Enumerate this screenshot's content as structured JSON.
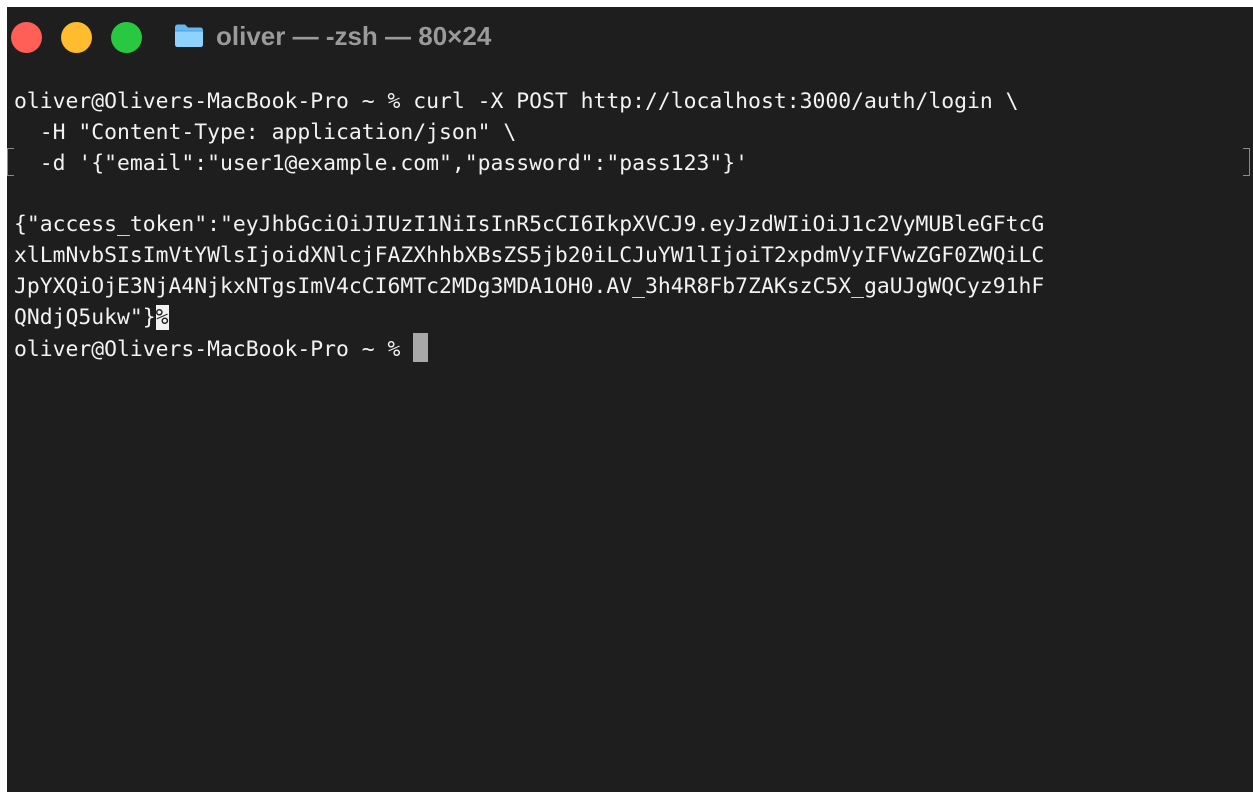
{
  "window": {
    "title": "oliver — -zsh — 80×24",
    "colors": {
      "background": "#1e1e1e",
      "text": "#f2f2f2",
      "title_text": "#9a9a9a",
      "close": "#ff5f57",
      "minimize": "#febc2e",
      "zoom": "#28c840",
      "cursor": "#a9a9a9"
    },
    "icons": {
      "folder": "folder-icon"
    }
  },
  "terminal": {
    "command_lines": [
      "oliver@Olivers-MacBook-Pro ~ % curl -X POST http://localhost:3000/auth/login \\",
      "  -H \"Content-Type: application/json\" \\",
      "  -d '{\"email\":\"user1@example.com\",\"password\":\"pass123\"}'"
    ],
    "blank_line": "",
    "output_lines": [
      "{\"access_token\":\"eyJhbGciOiJIUzI1NiIsInR5cCI6IkpXVCJ9.eyJzdWIiOiJ1c2VyMUBleGFtcG",
      "xlLmNvbSIsImVtYWlsIjoidXNlcjFAZXhhbXBsZS5jb20iLCJuYW1lIjoiT2xpdmVyIFVwZGF0ZWQiLC",
      "JpYXQiOjE3NjA4NjkxNTgsImV4cCI6MTc2MDg3MDA1OH0.AV_3h4R8Fb7ZAKszC5X_gaUJgWQCyz91hF"
    ],
    "last_output_line": "QNdjQ5ukw\"}",
    "partial_line_marker": "%",
    "final_prompt": "oliver@Olivers-MacBook-Pro ~ %"
  }
}
